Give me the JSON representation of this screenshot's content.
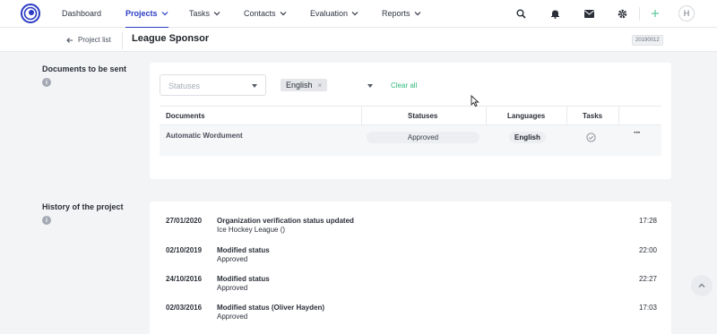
{
  "nav": {
    "items": [
      {
        "label": "Dashboard",
        "active": false,
        "dropdown": false
      },
      {
        "label": "Projects",
        "active": true,
        "dropdown": true
      },
      {
        "label": "Tasks",
        "active": false,
        "dropdown": true
      },
      {
        "label": "Contacts",
        "active": false,
        "dropdown": true
      },
      {
        "label": "Evaluation",
        "active": false,
        "dropdown": true
      },
      {
        "label": "Reports",
        "active": false,
        "dropdown": true
      }
    ],
    "icons": [
      "search-icon",
      "bell-icon",
      "mail-icon",
      "gear-icon",
      "plus-icon"
    ],
    "avatar_initial": "H",
    "accent": "#2b3cc4"
  },
  "subheader": {
    "back_label": "Project list",
    "title": "League Sponsor",
    "project_id": "20190012"
  },
  "documents": {
    "section_label": "Documents to be sent",
    "filters": {
      "statuses_placeholder": "Statuses",
      "language_chip": "English",
      "clear_all": "Clear all"
    },
    "columns": [
      "Documents",
      "Statuses",
      "Languages",
      "Tasks"
    ],
    "rows": [
      {
        "document": "Automatic Wordument",
        "status": "Approved",
        "language": "English",
        "task_done": true
      }
    ],
    "more_label": "···"
  },
  "history": {
    "section_label": "History of the project",
    "entries": [
      {
        "date": "27/01/2020",
        "title": "Organization verification status updated",
        "detail": "Ice Hockey League ()",
        "time": "17:28"
      },
      {
        "date": "02/10/2019",
        "title": "Modified status",
        "detail": "Approved",
        "time": "22:00"
      },
      {
        "date": "24/10/2016",
        "title": "Modified status",
        "detail": "Approved",
        "time": "22:27"
      },
      {
        "date": "02/03/2016",
        "title": "Modified status (Oliver Hayden)",
        "detail": "Approved",
        "time": "17:03"
      }
    ]
  },
  "colors": {
    "link_green": "#2fb87a",
    "background": "#f3f4f6"
  }
}
